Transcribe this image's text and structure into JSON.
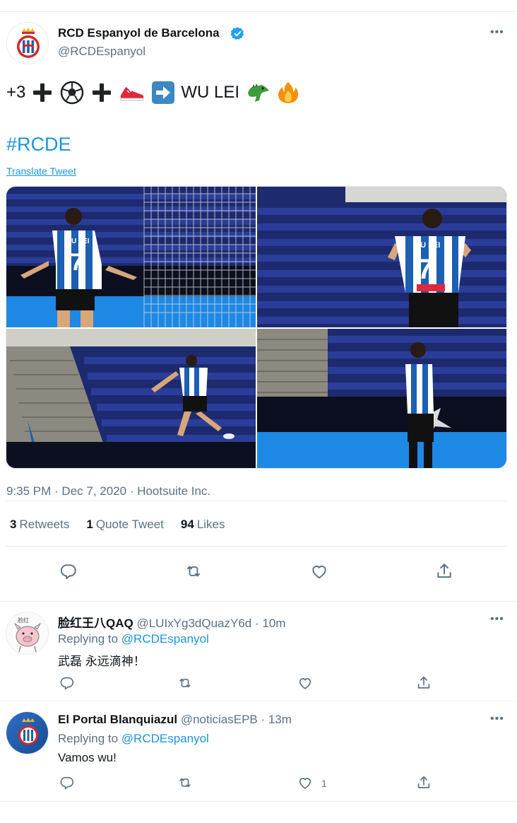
{
  "tweet": {
    "author_name": "RCD Espanyol de Barcelona",
    "author_handle": "@RCDEspanyol",
    "more": "•••",
    "text_prefix": "+3",
    "text_suffix": "WU LEI",
    "hashtag": "#RCDE",
    "translate_label": "Translate Tweet",
    "timestamp": "9:35 PM · Dec 7, 2020 · Hootsuite Inc.",
    "stats": {
      "retweets_count": "3",
      "retweets_label": "Retweets",
      "quotes_count": "1",
      "quotes_label": "Quote Tweet",
      "likes_count": "94",
      "likes_label": "Likes"
    },
    "photos": [
      {
        "player_name_on_shirt": "WU LEI",
        "number": "7"
      },
      {
        "player_name_on_shirt": "WU LEI",
        "number": "7"
      },
      {},
      {}
    ]
  },
  "replies": [
    {
      "name": "脸红王八QAQ",
      "meta": "@LUIxYg3dQuazY6d · 10m",
      "more": "•••",
      "replying_prefix": "Replying to",
      "replying_to": "@RCDEspanyol",
      "text": "武磊 永远滴神！",
      "like_count": ""
    },
    {
      "name": "El Portal Blanquiazul",
      "meta": "@noticiasEPB · 13m",
      "more": "•••",
      "replying_prefix": "Replying to",
      "replying_to": "@RCDEspanyol",
      "text": "Vamos wu!",
      "like_count": "1"
    }
  ],
  "colors": {
    "link": "#1b95e0",
    "secondary_text": "#5b7083",
    "primary_text": "#0f1419",
    "divider": "#e6ecf0",
    "verified": "#1da1f2"
  },
  "icons": [
    "verified-badge-icon",
    "plus-icon",
    "soccer-ball-icon",
    "sneaker-icon",
    "arrow-right-icon",
    "dragon-icon",
    "fire-icon",
    "reply-icon",
    "retweet-icon",
    "like-icon",
    "share-icon",
    "more-icon"
  ]
}
